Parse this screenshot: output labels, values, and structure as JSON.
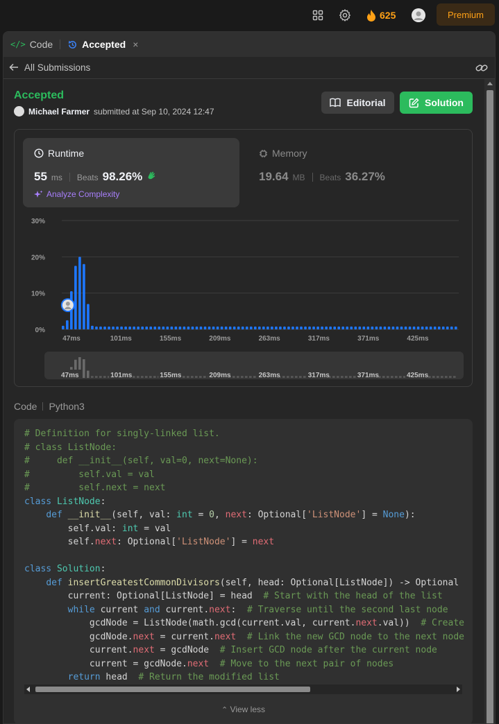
{
  "topbar": {
    "streak_count": "625",
    "premium_label": "Premium"
  },
  "tabs": {
    "code_label": "Code",
    "accepted_label": "Accepted",
    "close_glyph": "×"
  },
  "subbar": {
    "back_label": "All Submissions"
  },
  "submission": {
    "status": "Accepted",
    "user": "Michael Farmer",
    "submitted_text": "submitted at Sep 10, 2024 12:47",
    "editorial_label": "Editorial",
    "solution_label": "Solution"
  },
  "runtime": {
    "label": "Runtime",
    "value": "55",
    "unit": "ms",
    "beats_label": "Beats",
    "beats_value": "98.26%",
    "analyze_label": "Analyze Complexity"
  },
  "memory": {
    "label": "Memory",
    "value": "19.64",
    "unit": "MB",
    "beats_label": "Beats",
    "beats_value": "36.27%"
  },
  "chart_data": {
    "type": "bar",
    "title": "",
    "xlabel": "",
    "ylabel": "",
    "ylim": [
      0,
      30
    ],
    "y_ticks": [
      "30%",
      "20%",
      "10%",
      "0%"
    ],
    "x_ticks": [
      "47ms",
      "101ms",
      "155ms",
      "209ms",
      "263ms",
      "317ms",
      "371ms",
      "425ms"
    ],
    "values": [
      1,
      2.5,
      10.5,
      17.5,
      20,
      18,
      7,
      1,
      0.8,
      0.8,
      0.8,
      0.8,
      0.8,
      0.8,
      0.8,
      0.8,
      0.8,
      0.8,
      0.8,
      0.8,
      0.8,
      0.8,
      0.8,
      0.8,
      0.8,
      0.8,
      0.8,
      0.8,
      0.8,
      0.8,
      0.8,
      0.8,
      0.8,
      0.8,
      0.8,
      0.8,
      0.8,
      0.8,
      0.8,
      0.8,
      0.8,
      0.8,
      0.8,
      0.8,
      0.8,
      0.8,
      0.8,
      0.8,
      0.8,
      0.8,
      0.8,
      0.8,
      0.8,
      0.8,
      0.8,
      0.8,
      0.8,
      0.8,
      0.8,
      0.8,
      0.8,
      0.8,
      0.8,
      0.8,
      0.8,
      0.8,
      0.8,
      0.8,
      0.8,
      0.8,
      0.8,
      0.8,
      0.8,
      0.8,
      0.8,
      0.8,
      0.8,
      0.8,
      0.8,
      0.8,
      0.8,
      0.8,
      0.8,
      0.8,
      0.8,
      0.8,
      0.8,
      0.8,
      0.8,
      0.8,
      0.8,
      0.8,
      0.8,
      0.8,
      0.8
    ],
    "user_bar_index": 2,
    "bar_color": "#1e77ff",
    "grid": true
  },
  "code": {
    "label": "Code",
    "language": "Python3",
    "view_less_label": "View less",
    "lines": [
      [
        [
          "c",
          "# Definition for singly-linked list."
        ]
      ],
      [
        [
          "c",
          "# class ListNode:"
        ]
      ],
      [
        [
          "c",
          "#     def __init__(self, val=0, next=None):"
        ]
      ],
      [
        [
          "c",
          "#         self.val = val"
        ]
      ],
      [
        [
          "c",
          "#         self.next = next"
        ]
      ],
      [
        [
          "k",
          "class "
        ],
        [
          "cls",
          "ListNode"
        ],
        [
          "",
          ":"
        ]
      ],
      [
        [
          "",
          "    "
        ],
        [
          "k",
          "def "
        ],
        [
          "f",
          "__init__"
        ],
        [
          "",
          "(self, val: "
        ],
        [
          "cls",
          "int"
        ],
        [
          "",
          " = "
        ],
        [
          "n",
          "0"
        ],
        [
          "",
          ", "
        ],
        [
          "attr",
          "next"
        ],
        [
          "",
          ": Optional["
        ],
        [
          "s",
          "'ListNode'"
        ],
        [
          "",
          "] = "
        ],
        [
          "k",
          "None"
        ],
        [
          "",
          "):"
        ]
      ],
      [
        [
          "",
          "        self.val: "
        ],
        [
          "cls",
          "int"
        ],
        [
          "",
          " = val"
        ]
      ],
      [
        [
          "",
          "        self."
        ],
        [
          "attr",
          "next"
        ],
        [
          "",
          ": Optional["
        ],
        [
          "s",
          "'ListNode'"
        ],
        [
          "",
          "] = "
        ],
        [
          "attr",
          "next"
        ]
      ],
      [
        [
          "",
          ""
        ]
      ],
      [
        [
          "k",
          "class "
        ],
        [
          "cls",
          "Solution"
        ],
        [
          "",
          ":"
        ]
      ],
      [
        [
          "",
          "    "
        ],
        [
          "k",
          "def "
        ],
        [
          "f",
          "insertGreatestCommonDivisors"
        ],
        [
          "",
          "(self, head: Optional[ListNode]) -> Optional"
        ]
      ],
      [
        [
          "",
          "        current: Optional[ListNode] = head  "
        ],
        [
          "c",
          "# Start with the head of the list"
        ]
      ],
      [
        [
          "",
          "        "
        ],
        [
          "k",
          "while "
        ],
        [
          "",
          "current "
        ],
        [
          "k",
          "and "
        ],
        [
          "",
          "current."
        ],
        [
          "attr",
          "next"
        ],
        [
          "",
          ":  "
        ],
        [
          "c",
          "# Traverse until the second last node"
        ]
      ],
      [
        [
          "",
          "            gcdNode = ListNode(math.gcd(current.val, current."
        ],
        [
          "attr",
          "next"
        ],
        [
          "",
          ".val))  "
        ],
        [
          "c",
          "# Create"
        ]
      ],
      [
        [
          "",
          "            gcdNode."
        ],
        [
          "attr",
          "next"
        ],
        [
          "",
          " = current."
        ],
        [
          "attr",
          "next"
        ],
        [
          "",
          "  "
        ],
        [
          "c",
          "# Link the new GCD node to the next node"
        ]
      ],
      [
        [
          "",
          "            current."
        ],
        [
          "attr",
          "next"
        ],
        [
          "",
          " = gcdNode  "
        ],
        [
          "c",
          "# Insert GCD node after the current node"
        ]
      ],
      [
        [
          "",
          "            current = gcdNode."
        ],
        [
          "attr",
          "next"
        ],
        [
          "",
          "  "
        ],
        [
          "c",
          "# Move to the next pair of nodes"
        ]
      ],
      [
        [
          "",
          "        "
        ],
        [
          "k",
          "return "
        ],
        [
          "",
          "head  "
        ],
        [
          "c",
          "# Return the modified list"
        ]
      ]
    ]
  }
}
